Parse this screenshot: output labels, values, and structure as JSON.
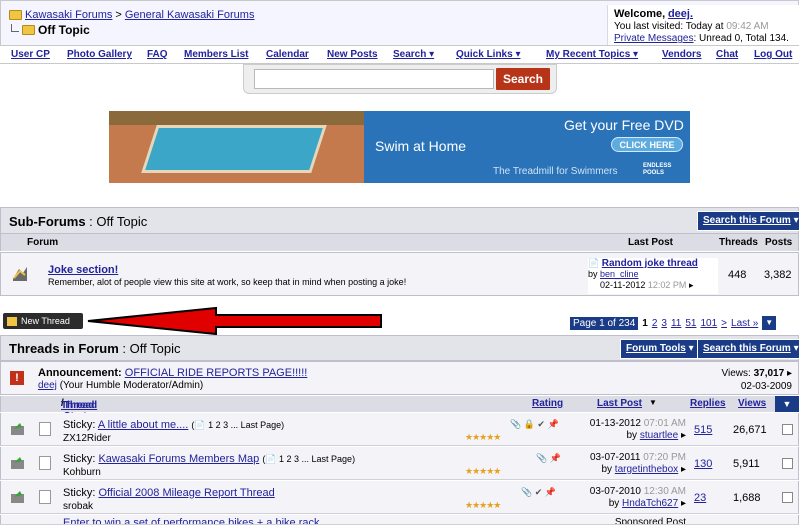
{
  "breadcrumb": {
    "root": "Kawasaki Forums",
    "sep": ">",
    "parent": "General Kawasaki Forums",
    "current": "Off Topic"
  },
  "welcome": {
    "greeting": "Welcome,",
    "user": "deej.",
    "last_visit_label": "You last visited: Today at",
    "last_visit_time": "09:42 AM",
    "pm_link": "Private Messages",
    "pm_text": ": Unread 0, Total 134."
  },
  "nav": [
    {
      "label": "User CP"
    },
    {
      "label": "Photo Gallery"
    },
    {
      "label": "FAQ"
    },
    {
      "label": "Members List"
    },
    {
      "label": "Calendar"
    },
    {
      "label": "New Posts"
    },
    {
      "label": "Search ▾"
    },
    {
      "label": "Quick Links ▾"
    },
    {
      "label": "My Recent Topics ▾"
    },
    {
      "label": "Vendors"
    },
    {
      "label": "Chat"
    },
    {
      "label": "Log Out"
    }
  ],
  "search": {
    "button": "Search",
    "value": ""
  },
  "banner": {
    "headline": "Get your Free DVD",
    "cta": "CLICK HERE",
    "tagline": "Swim at Home",
    "sub": "The Treadmill for Swimmers",
    "logo": "ENDLESS POOLS"
  },
  "subforums": {
    "title_bold": "Sub-Forums",
    "title_rest": " : Off Topic",
    "search_button": "Search this Forum",
    "columns": {
      "forum": "Forum",
      "last_post": "Last Post",
      "threads": "Threads",
      "posts": "Posts"
    },
    "rows": [
      {
        "name": "Joke section!",
        "desc": "Remember, alot of people view this site at work, so keep that in mind when posting a joke!",
        "last_title": "Random joke thread",
        "last_by_label": "by",
        "last_by": "ben_cline",
        "last_date": "02-11-2012",
        "last_time": "12:02 PM",
        "threads": "448",
        "posts": "3,382"
      }
    ]
  },
  "new_thread_button": "New Thread",
  "pager": {
    "label": "Page 1 of 234",
    "pages": [
      "1",
      "2",
      "3",
      "11",
      "51",
      "101",
      ">",
      "Last »"
    ]
  },
  "threads": {
    "title_bold": "Threads in Forum",
    "title_rest": " : Off Topic",
    "tools_button": "Forum Tools",
    "search_button": "Search this Forum",
    "announcement": {
      "label": "Announcement:",
      "title": "OFFICIAL RIDE REPORTS PAGE!!!!!",
      "author": "deej",
      "author_title": "(Your Humble Moderator/Admin)",
      "views_label": "Views:",
      "views": "37,017",
      "date": "02-03-2009"
    },
    "columns": {
      "thread": "Thread",
      "slash": " / ",
      "starter": "Thread Starter",
      "rating": "Rating",
      "last_post": "Last Post",
      "replies": "Replies",
      "views": "Views"
    },
    "rows": [
      {
        "prefix": "Sticky:",
        "title": "A little about me....",
        "pages": "(📄 1 2 3 ... Last Page)",
        "starter": "ZX12Rider",
        "icons": "📎 🔒 ✔ 📌",
        "last_date": "01-13-2012",
        "last_time": "07:01 AM",
        "last_by": "stuartlee",
        "replies": "515",
        "views": "26,671"
      },
      {
        "prefix": "Sticky:",
        "title": "Kawasaki Forums Members Map",
        "pages": "(📄 1 2 3 ... Last Page)",
        "starter": "Kohburn",
        "icons": "📎 📌",
        "last_date": "03-07-2011",
        "last_time": "07:20 PM",
        "last_by": "targetinthebox",
        "replies": "130",
        "views": "5,911"
      },
      {
        "prefix": "Sticky:",
        "title": "Official 2008 Mileage Report Thread",
        "pages": "",
        "starter": "srobak",
        "icons": "📎 ✔ 📌",
        "last_date": "03-07-2010",
        "last_time": "12:30 AM",
        "last_by": "HndaTch627",
        "replies": "23",
        "views": "1,688"
      }
    ],
    "partial_row": {
      "title": "Enter to win a set of performance bikes + a bike rack",
      "last": "Sponsored Post"
    }
  },
  "colors": {
    "nav_link": "#22229c",
    "dark_blue": "#1a3b86",
    "search_btn": "#b83418",
    "arrow": "#e00000"
  }
}
